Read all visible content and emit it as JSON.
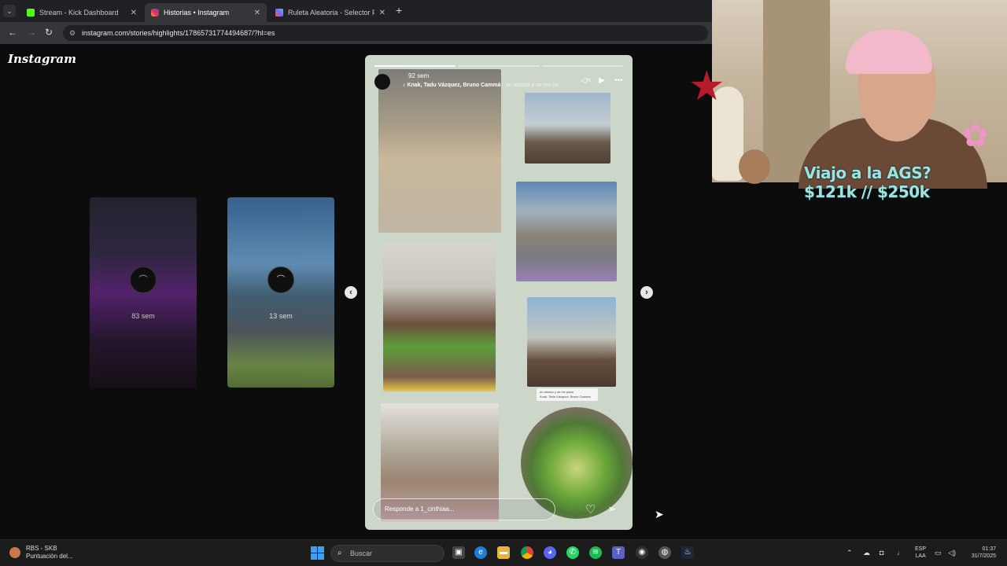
{
  "browser": {
    "tabs": [
      {
        "title": "Stream - Kick Dashboard",
        "color": "#53fc18",
        "active": false
      },
      {
        "title": "Historias • Instagram",
        "color": "#e1306c",
        "active": true
      },
      {
        "title": "Ruleta Aleatoria - Selector Pers",
        "color": "#7b68ee",
        "active": false
      }
    ],
    "url": "instagram.com/stories/highlights/17865731774494687/?hl=es"
  },
  "instagram": {
    "logo": "Instagram",
    "side_stories": [
      {
        "age": "83 sem"
      },
      {
        "age": "13 sem"
      }
    ],
    "story": {
      "age": "92 sem",
      "song": "Knak, Tadu Vázquez, Bruno Cammá",
      "song_extra": " · un abrazo y se me pa",
      "reply_placeholder": "Responde a 1_cinthiaa...",
      "sticker_line1": "un abrazo y se me pasa",
      "sticker_line2": "Knak, Tadu Vázquez, Bruno Cammá"
    }
  },
  "overlay": {
    "line1": "Viajo a la AGS?",
    "line2": "$121k // $250k"
  },
  "taskbar": {
    "weather_title": "RBS - SKB",
    "weather_sub": "Puntuación del...",
    "search_placeholder": "Buscar",
    "lang_top": "ESP",
    "lang_bottom": "LAA",
    "time": "01:37",
    "date": "31/7/2025"
  }
}
